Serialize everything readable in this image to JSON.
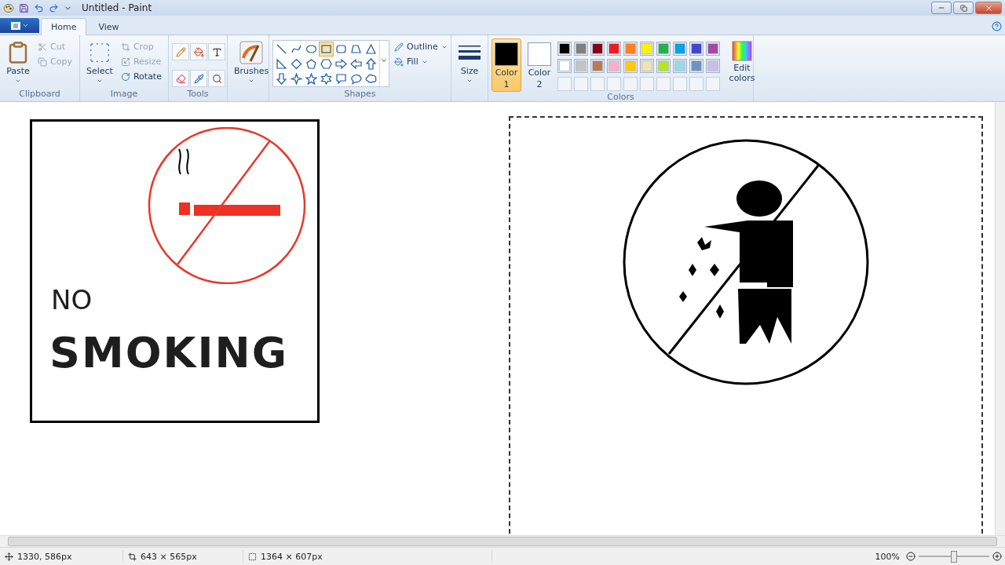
{
  "window": {
    "title": "Untitled - Paint"
  },
  "tabs": [
    {
      "label": "Home",
      "selected": true
    },
    {
      "label": "View",
      "selected": false
    }
  ],
  "clipboard": {
    "label": "Clipboard",
    "paste": "Paste",
    "items": [
      {
        "kind": "cut",
        "label": "Cut",
        "disabled": true
      },
      {
        "kind": "copy",
        "label": "Copy",
        "disabled": true
      }
    ]
  },
  "image": {
    "label": "Image",
    "select": "Select",
    "items": [
      {
        "kind": "crop",
        "label": "Crop",
        "disabled": true
      },
      {
        "kind": "resize",
        "label": "Resize",
        "disabled": true
      },
      {
        "kind": "rotate",
        "label": "Rotate",
        "disabled": false
      }
    ]
  },
  "tools": {
    "label": "Tools"
  },
  "brushes": {
    "label": "Brushes"
  },
  "shapes": {
    "label": "Shapes",
    "outline": "Outline",
    "fill": "Fill",
    "items": [
      {
        "kind": "line",
        "selected": false
      },
      {
        "kind": "curve",
        "selected": false
      },
      {
        "kind": "oval",
        "selected": false
      },
      {
        "kind": "rectangle",
        "selected": true
      },
      {
        "kind": "rounded-rectangle",
        "selected": false
      },
      {
        "kind": "polygon",
        "selected": false
      },
      {
        "kind": "triangle",
        "selected": false
      },
      {
        "kind": "right-triangle",
        "selected": false
      },
      {
        "kind": "diamond",
        "selected": false
      },
      {
        "kind": "pentagon",
        "selected": false
      },
      {
        "kind": "hexagon",
        "selected": false
      },
      {
        "kind": "right-arrow",
        "selected": false
      },
      {
        "kind": "left-arrow",
        "selected": false
      },
      {
        "kind": "up-arrow",
        "selected": false
      },
      {
        "kind": "down-arrow",
        "selected": false
      },
      {
        "kind": "four-star",
        "selected": false
      },
      {
        "kind": "five-star",
        "selected": false
      },
      {
        "kind": "six-star",
        "selected": false
      },
      {
        "kind": "rect-callout",
        "selected": false
      },
      {
        "kind": "oval-callout",
        "selected": false
      },
      {
        "kind": "cloud-callout",
        "selected": false
      }
    ]
  },
  "size": {
    "label": "Size"
  },
  "colors": {
    "label": "Colors",
    "edit": "Edit colors",
    "current": [
      {
        "label": "Color",
        "number": "1",
        "selected": true,
        "color": "#000000"
      },
      {
        "label": "Color",
        "number": "2",
        "selected": false,
        "color": "#ffffff"
      }
    ],
    "palette": [
      {
        "color": "#000000"
      },
      {
        "color": "#7f7f7f"
      },
      {
        "color": "#880015"
      },
      {
        "color": "#ed1c24"
      },
      {
        "color": "#ff7f27"
      },
      {
        "color": "#fff200"
      },
      {
        "color": "#22b14c"
      },
      {
        "color": "#00a2e8"
      },
      {
        "color": "#3f48cc"
      },
      {
        "color": "#a349a4"
      },
      {
        "color": "#ffffff"
      },
      {
        "color": "#c3c3c3"
      },
      {
        "color": "#b97a57"
      },
      {
        "color": "#ffaec9"
      },
      {
        "color": "#ffc90e"
      },
      {
        "color": "#efe4b0"
      },
      {
        "color": "#b5e61d"
      },
      {
        "color": "#99d9ea"
      },
      {
        "color": "#7092be"
      },
      {
        "color": "#c8bfe7"
      }
    ]
  },
  "canvas": {
    "sign": {
      "line1": "NO",
      "line2": "SMOKING"
    }
  },
  "status_bar": {
    "cursor": "1330, 586px",
    "selection": "643 × 565px",
    "image_size": "1364 × 607px",
    "zoom": "100%",
    "zoom_slider": {
      "level": 0.5
    }
  }
}
